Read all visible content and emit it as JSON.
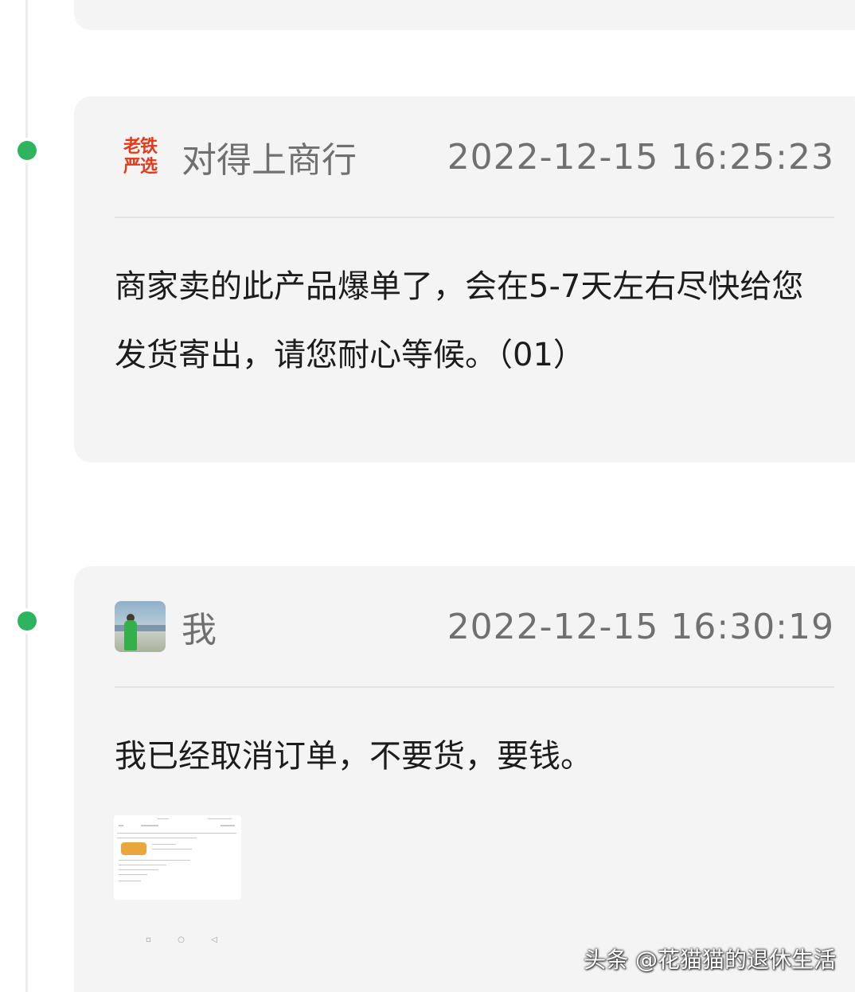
{
  "messages": [
    {
      "sender": "对得上商行",
      "avatar_text": [
        "老铁",
        "严选"
      ],
      "timestamp": "2022-12-15 16:25:23",
      "text": "商家卖的此产品爆单了，会在5-7天左右尽快给您发货寄出，请您耐心等候。（01）"
    },
    {
      "sender": "我",
      "timestamp": "2022-12-15 16:30:19",
      "text": "我已经取消订单，不要货，要钱。",
      "attachment_icon": "order-screenshot-thumbnail"
    }
  ],
  "nav_keys": [
    "▫",
    "○",
    "◁"
  ],
  "watermark": "头条 @花猫猫的退休生活",
  "colors": {
    "timeline_dot": "#2eb45f",
    "brand_red": "#e23a1a",
    "card_bg": "#f4f4f4"
  }
}
